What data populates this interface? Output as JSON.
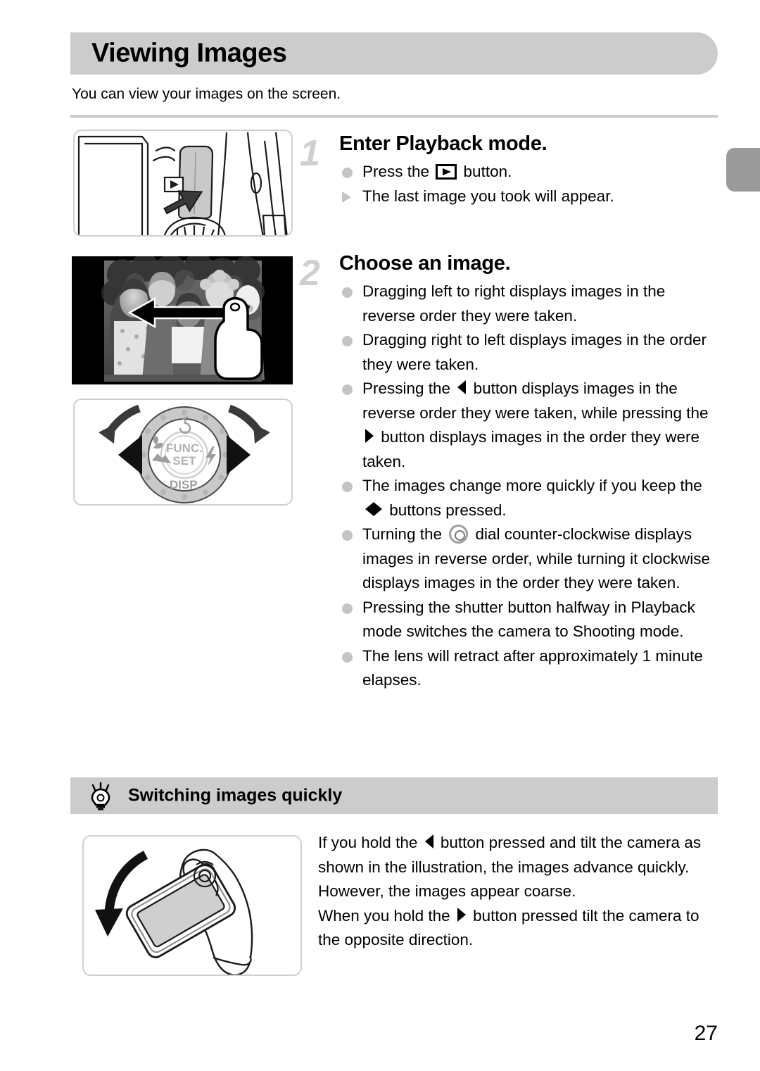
{
  "page": {
    "title": "Viewing Images",
    "intro": "You can view your images on the screen.",
    "number": "27",
    "accent_gray": "#cccccc",
    "bullet_gray": "#c4c4c4",
    "tab_gray": "#9b9b9b"
  },
  "steps": [
    {
      "number": "1",
      "heading": "Enter Playback mode.",
      "lines": [
        {
          "marker": "dot",
          "pre": "Press the ",
          "icon": "playback-icon",
          "post": " button."
        },
        {
          "marker": "triangle",
          "pre": "The last image you took will appear.",
          "icon": "",
          "post": ""
        }
      ]
    },
    {
      "number": "2",
      "heading": "Choose an image.",
      "lines": [
        {
          "marker": "dot",
          "pre": "Dragging left to right displays images in the reverse order they were taken.",
          "icon": "",
          "post": ""
        },
        {
          "marker": "dot",
          "pre": "Dragging right to left displays images in the order they were taken.",
          "icon": "",
          "post": ""
        },
        {
          "marker": "dot",
          "pre": "Pressing the ",
          "icon": "left-arrow-icon",
          "post": " button displays images in the reverse order they were taken, while pressing the ",
          "icon2": "right-arrow-icon",
          "post2": " button displays images in the order they were taken."
        },
        {
          "marker": "dot",
          "pre": "The images change more quickly if you keep the ",
          "icon": "left-right-arrow-icon",
          "post": " buttons pressed."
        },
        {
          "marker": "dot",
          "pre": "Turning the ",
          "icon": "control-dial-icon",
          "post": " dial counter-clockwise displays images in reverse order, while turning it clockwise displays images in the order they were taken."
        },
        {
          "marker": "dot",
          "pre": "Pressing the shutter button halfway in Playback mode switches the camera to Shooting mode.",
          "icon": "",
          "post": ""
        },
        {
          "marker": "dot",
          "pre": "The lens will retract after approximately 1 minute elapses.",
          "icon": "",
          "post": ""
        }
      ]
    }
  ],
  "tip": {
    "icon": "lightbulb-icon",
    "title": "Switching images quickly",
    "para1_pre": "If you hold the ",
    "para1_icon": "left-arrow-icon",
    "para1_post": " button pressed and tilt the camera as shown in the illustration, the images advance quickly. However, the images appear coarse.",
    "para2_pre": "When you hold the ",
    "para2_icon": "right-arrow-icon",
    "para2_post": " button pressed tilt the camera to the opposite direction."
  },
  "illustrations": {
    "camera_back": {
      "name": "camera-back-playback-button-illustration"
    },
    "photo": {
      "name": "photo-drag-illustration"
    },
    "dial": {
      "name": "control-dial-illustration",
      "center_label": "FUNC.",
      "center_label2": "SET",
      "bottom_label": "DISP."
    },
    "tilt": {
      "name": "camera-tilt-illustration"
    }
  }
}
